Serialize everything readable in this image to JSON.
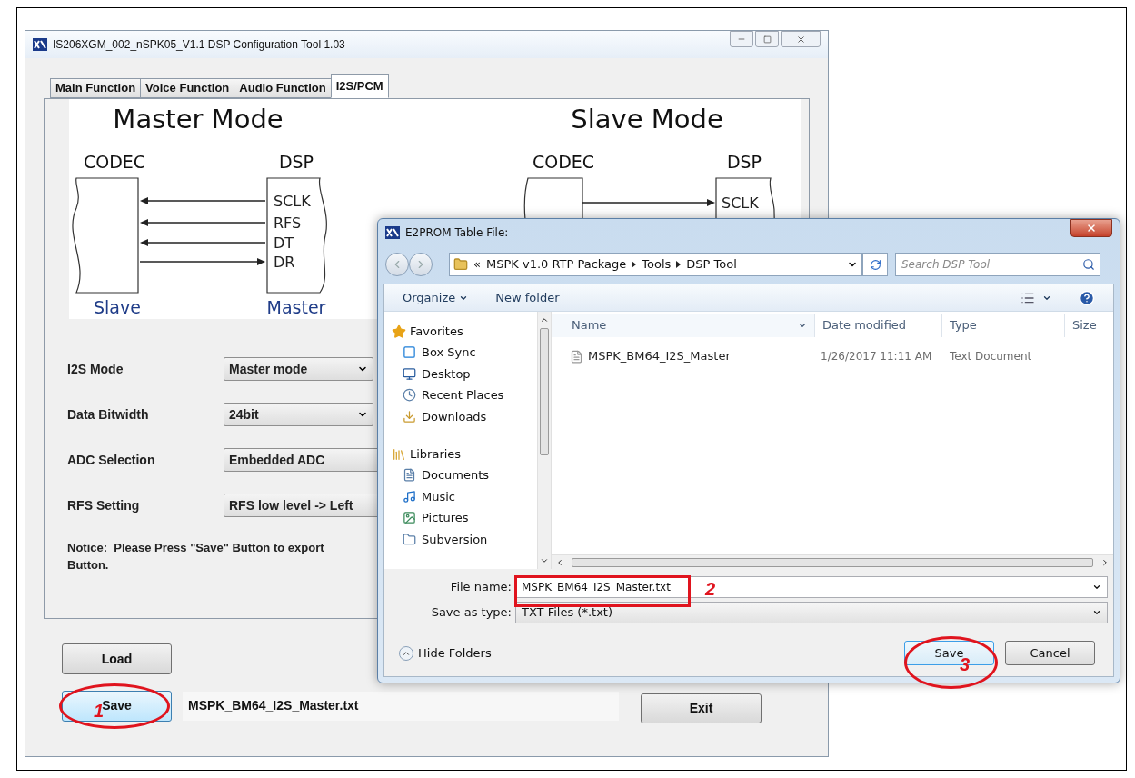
{
  "main_window": {
    "title": "IS206XGM_002_nSPK05_V1.1 DSP Configuration Tool 1.03",
    "tabs": [
      {
        "label": "Main Function",
        "selected": false
      },
      {
        "label": "Voice Function",
        "selected": false
      },
      {
        "label": "Audio Function",
        "selected": false
      },
      {
        "label": "I2S/PCM",
        "selected": true
      }
    ],
    "diagram": {
      "modes": [
        {
          "title": "Master Mode",
          "codec_label": "CODEC",
          "dsp_label": "DSP",
          "codec_role": "Slave",
          "dsp_role": "Master",
          "signals": [
            {
              "label": "SCLK",
              "kind": "leftward"
            },
            {
              "label": "RFS",
              "kind": "leftward"
            },
            {
              "label": "DT",
              "kind": "leftward"
            },
            {
              "label": "DR",
              "kind": "rightward"
            }
          ]
        },
        {
          "title": "Slave Mode",
          "codec_label": "CODEC",
          "dsp_label": "DSP",
          "signals": [
            {
              "label": "SCLK",
              "kind": "rightward"
            }
          ]
        }
      ]
    },
    "settings": [
      {
        "label": "I2S Mode",
        "value": "Master mode"
      },
      {
        "label": "Data Bitwidth",
        "value": "24bit"
      },
      {
        "label": "ADC Selection",
        "value": "Embedded ADC"
      },
      {
        "label": "RFS Setting",
        "value": "RFS low level -> Left"
      }
    ],
    "notice": [
      "Notice:  Please Press \"Save\" Button to export",
      "Button."
    ],
    "buttons": [
      {
        "label": "Load",
        "focused": false
      },
      {
        "label": "Save",
        "focused": true
      }
    ],
    "file_name": "MSPK_BM64_I2S_Master.txt",
    "exit_button": "Exit"
  },
  "dialog": {
    "title": "E2PROM Table File:",
    "breadcrumb": [
      "«",
      "MSPK v1.0 RTP Package",
      "Tools",
      "DSP Tool"
    ],
    "search": {
      "placeholder": "Search DSP Tool"
    },
    "toolbar": [
      "Organize",
      "New folder"
    ],
    "nav": [
      {
        "label": "Favorites",
        "children": [
          {
            "label": "Box Sync"
          },
          {
            "label": "Desktop"
          },
          {
            "label": "Recent Places"
          },
          {
            "label": "Downloads"
          }
        ]
      },
      {
        "label": "Libraries",
        "children": [
          {
            "label": "Documents"
          },
          {
            "label": "Music"
          },
          {
            "label": "Pictures"
          },
          {
            "label": "Subversion"
          }
        ]
      }
    ],
    "columns": [
      "Name",
      "Date modified",
      "Type",
      "Size"
    ],
    "files": [
      {
        "name": "MSPK_BM64_I2S_Master",
        "date": "1/26/2017 11:11 AM",
        "type": "Text Document",
        "selected": false
      }
    ],
    "file_name": {
      "label": "File name:",
      "value": "MSPK_BM64_I2S_Master.txt"
    },
    "save_as_type": {
      "label": "Save as type:",
      "value": "TXT Files (*.txt)"
    },
    "hide_folders": "Hide Folders",
    "buttons": [
      {
        "label": "Save",
        "default": true
      },
      {
        "label": "Cancel",
        "default": false
      }
    ]
  },
  "annotations": [
    {
      "label": "1",
      "kind": "ellipse"
    },
    {
      "label": "2",
      "kind": "rect"
    },
    {
      "label": "3",
      "kind": "ellipse"
    }
  ]
}
